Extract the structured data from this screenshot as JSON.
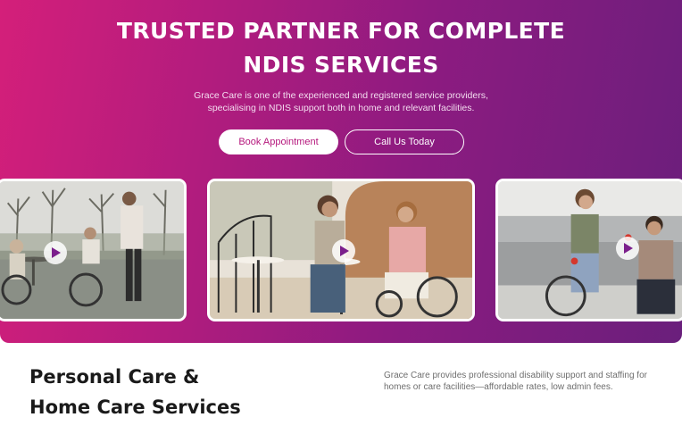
{
  "hero": {
    "title_line1": "TRUSTED PARTNER FOR COMPLETE",
    "title_line2": "NDIS SERVICES",
    "subtitle_line1": "Grace Care is one of the experienced and registered service providers,",
    "subtitle_line2": "specialising in NDIS support both in home and relevant facilities.",
    "buttons": {
      "book": "Book Appointment",
      "call": "Call Us Today"
    },
    "gradient": [
      "#d41f7a",
      "#6a1f7c"
    ]
  },
  "videos": [
    {
      "icon": "play-icon"
    },
    {
      "icon": "play-icon"
    },
    {
      "icon": "play-icon"
    }
  ],
  "section": {
    "title_line1": "Personal Care &",
    "title_line2": "Home Care Services",
    "desc_line1": "Grace Care provides professional disability support and staffing for",
    "desc_line2": "homes or care facilities—affordable rates, low admin fees."
  },
  "colors": {
    "accent": "#b5177c",
    "play": "#7b1f8c"
  }
}
